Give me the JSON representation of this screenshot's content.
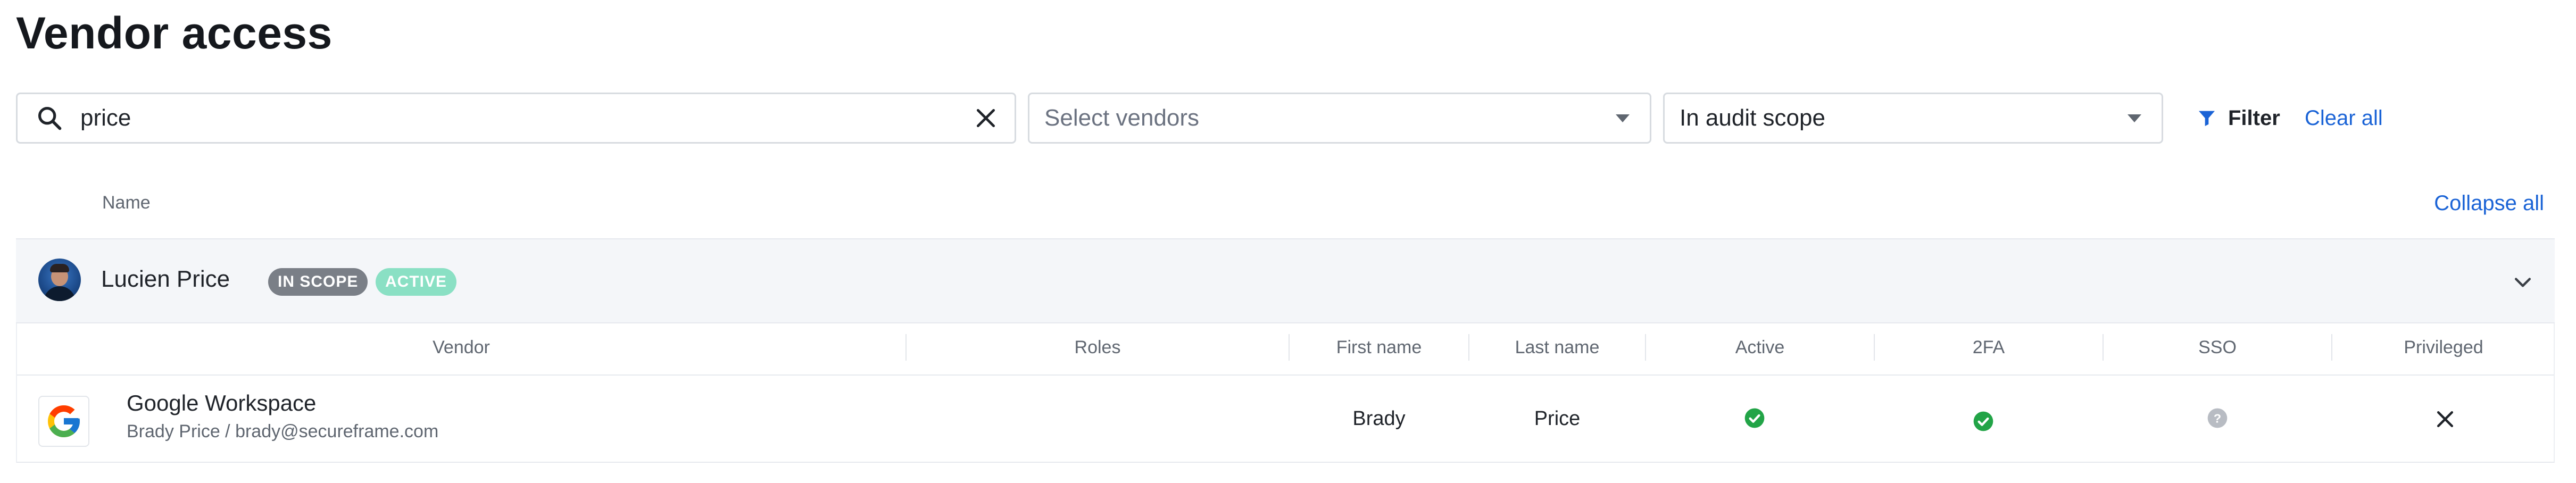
{
  "page": {
    "title": "Vendor access"
  },
  "toolbar": {
    "search_value": "price",
    "search_icon": "search-icon",
    "clear_icon": "close-icon",
    "vendors_placeholder": "Select vendors",
    "scope_value": "In audit scope",
    "filter_label": "Filter",
    "clear_all_label": "Clear all"
  },
  "list": {
    "name_header": "Name",
    "collapse_all_label": "Collapse all"
  },
  "person": {
    "name": "Lucien Price",
    "badges": [
      "IN SCOPE",
      "ACTIVE"
    ],
    "expand_icon": "chevron-down-icon"
  },
  "table": {
    "headers": [
      "Vendor",
      "Roles",
      "First name",
      "Last name",
      "Active",
      "2FA",
      "SSO",
      "Privileged"
    ],
    "rows": [
      {
        "vendor": "Google Workspace",
        "account": "Brady Price / brady@secureframe.com",
        "roles": "",
        "first_name": "Brady",
        "last_name": "Price",
        "active": "check-icon",
        "twofa": "check-icon",
        "sso": "question-icon",
        "privileged": "x-icon"
      }
    ]
  },
  "colors": {
    "link": "#1a63d6",
    "success": "#22a447",
    "badge_scope": "#7a7f87",
    "badge_active": "#8ae0c4"
  }
}
